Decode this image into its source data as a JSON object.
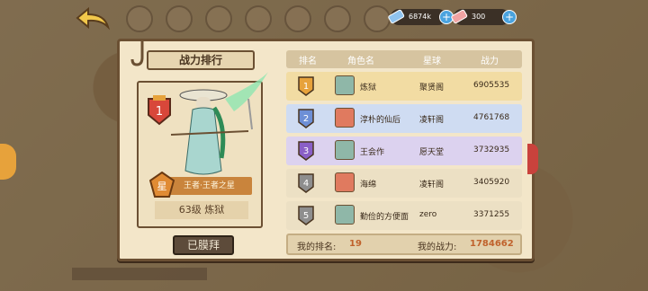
{
  "resources": [
    {
      "icon": "ticket-blue-icon",
      "value": "6874k"
    },
    {
      "icon": "ticket-red-icon",
      "value": "300"
    }
  ],
  "panel": {
    "title": "战力排行",
    "hero": {
      "rank": "1",
      "title_badge": "星",
      "title_text": "王者·王者之星",
      "level_name": "63级  炼狱"
    },
    "worship_button": "已膜拜"
  },
  "table": {
    "headers": [
      "排名",
      "角色名",
      "星球",
      "战力"
    ],
    "rows": [
      {
        "rank": "1",
        "name": "炼狱",
        "planet": "聚贤阁",
        "power": "6905535",
        "bg": "#f2dca3"
      },
      {
        "rank": "2",
        "name": "淳朴的仙后",
        "planet": "凌轩阁",
        "power": "4761768",
        "bg": "#cfdcf2"
      },
      {
        "rank": "3",
        "name": "王会作",
        "planet": "愿天堂",
        "power": "3732935",
        "bg": "#dcd2ef"
      },
      {
        "rank": "4",
        "name": "海绵",
        "planet": "凌轩阁",
        "power": "3405920",
        "bg": "#ece0c4"
      },
      {
        "rank": "5",
        "name": "勤俭的方便面",
        "planet": "zero",
        "power": "3371255",
        "bg": "#ece0c4"
      }
    ]
  },
  "footer": {
    "my_rank_label": "我的排名:",
    "my_rank": "19",
    "my_power_label": "我的战力:",
    "my_power": "1784662"
  },
  "colors": {
    "gold": "#e7a23b",
    "silver": "#6d8fd6",
    "bronze": "#8a5fc7",
    "plain": "#8e8e8e"
  }
}
